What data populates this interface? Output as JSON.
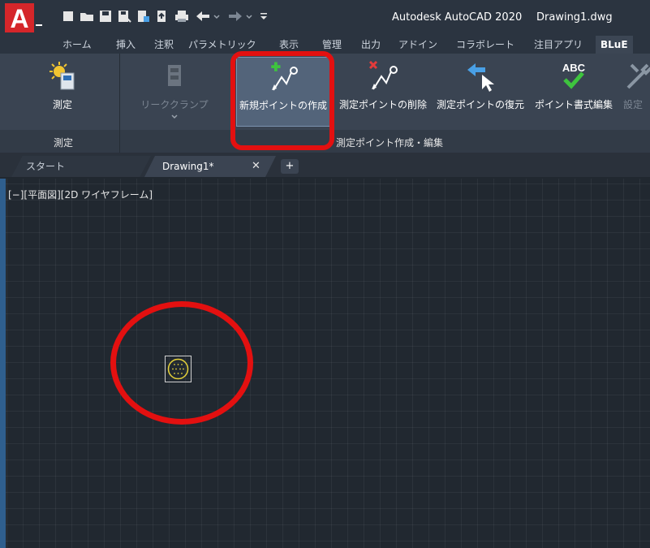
{
  "titlebar": {
    "app_logo_letter": "A",
    "window_title": "Autodesk AutoCAD 2020",
    "file_name": "Drawing1.dwg",
    "quick_access": [
      "new-file-icon",
      "open-folder-icon",
      "save-icon",
      "save-as-icon",
      "export-icon",
      "share-icon",
      "print-icon",
      "undo-icon",
      "redo-icon",
      "qat-menu-icon"
    ]
  },
  "ribbon_tabs": [
    "ホーム",
    "挿入",
    "注釈",
    "パラメトリック",
    "表示",
    "管理",
    "出力",
    "アドイン",
    "コラボレート",
    "注目アプリ",
    "BLuE"
  ],
  "ribbon_active_tab": "BLuE",
  "ribbon": {
    "buttons": [
      {
        "label": "測定",
        "icon": "measure-icon",
        "enabled": true
      },
      {
        "label": "リーククランプ",
        "icon": "leak-clamp-icon",
        "enabled": false
      },
      {
        "label": "新規ポイントの作成",
        "icon": "new-point-icon",
        "enabled": true,
        "highlighted": true
      },
      {
        "label": "測定ポイントの削除",
        "icon": "delete-point-icon",
        "enabled": true
      },
      {
        "label": "測定ポイントの復元",
        "icon": "restore-point-icon",
        "enabled": true
      },
      {
        "label": "ポイント書式編集",
        "icon": "abc-check-icon",
        "enabled": true
      },
      {
        "label": "設定",
        "icon": "tools-icon",
        "enabled": false
      }
    ],
    "panel_titles": [
      "測定",
      "測定ポイント作成・編集"
    ]
  },
  "document_tabs": {
    "start_label": "スタート",
    "drawing_label": "Drawing1*",
    "close_glyph": "✕",
    "add_glyph": "+"
  },
  "viewport": {
    "label": "[−][平面図][2D ワイヤフレーム]"
  },
  "colors": {
    "highlight": "#e31010",
    "canvas": "#212830",
    "ribbon": "#3a4452",
    "point_marker": "#e6d23a"
  }
}
